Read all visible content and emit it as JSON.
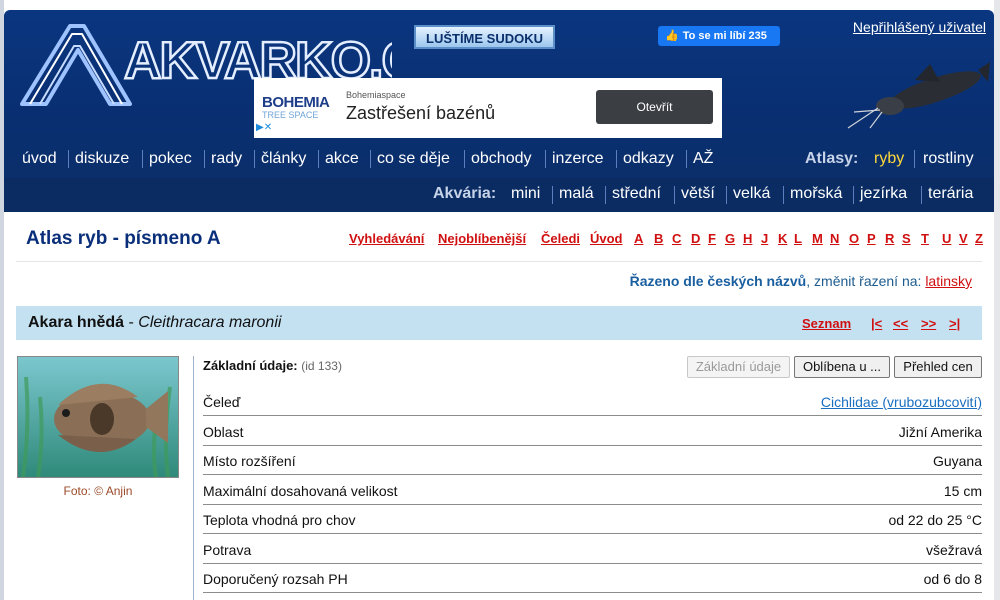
{
  "header": {
    "logo_text": "AKVARKO.CZ",
    "sudoku_label": "LUŠTÍME SUDOKU",
    "fb_like": "To se mi líbí 235",
    "user_link": "Nepřihlášený uživatel"
  },
  "ad": {
    "brand": "BOHEMIA",
    "brand_sub": "TREE SPACE",
    "small": "Bohemiaspace",
    "headline": "Zastřešení bazénů",
    "button": "Otevřít"
  },
  "nav": {
    "items": [
      "úvod",
      "diskuze",
      "pokec",
      "rady",
      "články",
      "akce",
      "co se děje",
      "obchody",
      "inzerce",
      "odkazy",
      "AŽ"
    ],
    "atlasy_label": "Atlasy:",
    "atlasy": [
      "ryby",
      "rostliny"
    ]
  },
  "bar2": {
    "label": "Akvária:",
    "items": [
      "mini",
      "malá",
      "střední",
      "větší",
      "velká",
      "mořská",
      "jezírka",
      "terária"
    ]
  },
  "page": {
    "title": "Atlas ryb - písmeno A",
    "links": [
      "Vyhledávání",
      "Nejoblíbenější",
      "Čeledi",
      "Úvod",
      "A",
      "B",
      "C",
      "D",
      "F",
      "G",
      "H",
      "J",
      "K",
      "L",
      "M",
      "N",
      "O",
      "P",
      "R",
      "S",
      "T",
      "U",
      "V",
      "Z"
    ],
    "sort_prefix": "Řazeno dle českých názvů",
    "sort_mid": ", změnit řazení na: ",
    "sort_link": "latinsky"
  },
  "fish": {
    "name": "Akara hnědá",
    "dash": " - ",
    "latin": "Cleithracara maronii",
    "seznam": "Seznam",
    "pager": [
      "|<",
      "<<",
      ">>",
      ">|"
    ],
    "photo_caption": "Foto: © Anjin"
  },
  "details": {
    "title": "Základní údaje:",
    "id": "(id 133)",
    "tabs": [
      "Základní údaje",
      "Oblíbena u ...",
      "Přehled cen"
    ],
    "rows": [
      {
        "k": "Čeleď",
        "v": "Cichlidae (vrubozubcovití)"
      },
      {
        "k": "Oblast",
        "v": "Jižní Amerika"
      },
      {
        "k": "Místo rozšíření",
        "v": "Guyana"
      },
      {
        "k": "Maximální dosahovaná velikost",
        "v": "15 cm"
      },
      {
        "k": "Teplota vhodná pro chov",
        "v": "od 22 do 25 °C"
      },
      {
        "k": "Potrava",
        "v": "všežravá"
      },
      {
        "k": "Doporučený rozsah PH",
        "v": "od 6 do 8"
      }
    ]
  },
  "colors": {
    "header": "#0a3680",
    "link_red": "#d01010",
    "band": "#c4e1f2",
    "title_blue": "#0a2f7a"
  }
}
